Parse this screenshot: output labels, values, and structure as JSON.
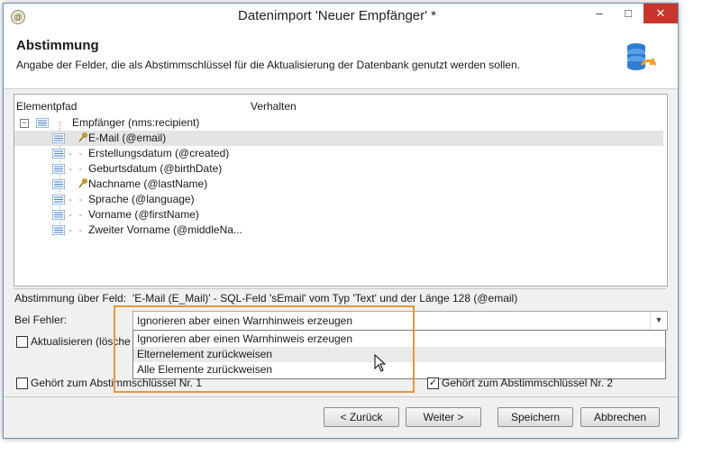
{
  "window": {
    "title": "Datenimport 'Neuer Empfänger' *",
    "minimize": "–",
    "maximize": "□",
    "close": "✕"
  },
  "header": {
    "title": "Abstimmung",
    "subtitle": "Angabe der Felder, die als Abstimmschlüssel für die Aktualisierung der Datenbank genutzt werden sollen."
  },
  "tree": {
    "columns": [
      "Elementpfad",
      "Verhalten"
    ],
    "root": "Empfänger (nms:recipient)",
    "items": [
      {
        "label": "E-Mail (@email)",
        "key": true,
        "selected": true
      },
      {
        "label": "Erstellungsdatum (@created)",
        "key": false
      },
      {
        "label": "Geburtsdatum (@birthDate)",
        "key": false
      },
      {
        "label": "Nachname (@lastName)",
        "key": true
      },
      {
        "label": "Sprache (@language)",
        "key": false
      },
      {
        "label": "Vorname (@firstName)",
        "key": false
      },
      {
        "label": "Zweiter Vorname (@middleNa...",
        "key": false
      }
    ]
  },
  "reconcile": {
    "label": "Abstimmung über Feld:",
    "value": "'E-Mail (E_Mail)' - SQL-Feld 'sEmail' vom Typ 'Text' und der Länge 128 (@email)"
  },
  "error": {
    "label": "Bei Fehler:",
    "selected": "Ignorieren aber einen Warnhinweis erzeugen",
    "options": [
      "Ignorieren aber einen Warnhinweis erzeugen",
      "Elternelement zurückweisen",
      "Alle Elemente zurückweisen"
    ]
  },
  "checkboxes": {
    "update": "Aktualisieren (lösche",
    "key1": "Gehört zum Abstimmschlüssel Nr. 1",
    "key2": "Gehört zum Abstimmschlüssel Nr. 2"
  },
  "buttons": {
    "back": "< Zurück",
    "next": "Weiter >",
    "save": "Speichern",
    "cancel": "Abbrechen"
  },
  "colors": {
    "highlight": "#e8963a",
    "close": "#c7352d",
    "list_icon": "#3d7cc9",
    "key_icon": "#d4a017"
  }
}
